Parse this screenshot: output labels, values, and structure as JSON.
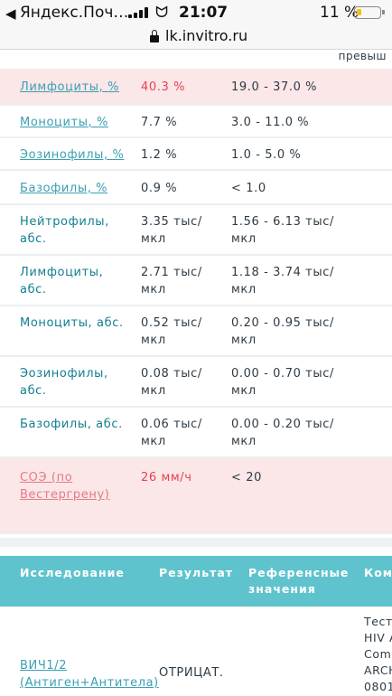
{
  "status_bar": {
    "back_label": "◀",
    "app_name": "Яндекс.Поч…",
    "wifi_glyph": "ᗢ",
    "time": "21:07",
    "battery_percent": "11 %",
    "battery_level": 0.11,
    "battery_color": "#f2c21b"
  },
  "url_bar": {
    "url": "lk.invitro.ru"
  },
  "table": {
    "partial_header": "превыш",
    "rows": [
      {
        "name": [
          "Лимфоциты, %"
        ],
        "value": [
          "40.3 %"
        ],
        "ref": [
          "19.0 - 37.0 %"
        ],
        "flagged": true,
        "link": true
      },
      {
        "name": [
          "Моноциты, %"
        ],
        "value": [
          "7.7 %"
        ],
        "ref": [
          "3.0 - 11.0 %"
        ],
        "flagged": false,
        "link": true
      },
      {
        "name": [
          "Эозинофилы, %"
        ],
        "value": [
          "1.2 %"
        ],
        "ref": [
          "1.0 - 5.0 %"
        ],
        "flagged": false,
        "link": true
      },
      {
        "name": [
          "Базофилы, %"
        ],
        "value": [
          "0.9 %"
        ],
        "ref": [
          "< 1.0"
        ],
        "flagged": false,
        "link": true
      },
      {
        "name": [
          "Нейтрофилы,",
          "абс."
        ],
        "value": [
          "3.35 тыс/",
          "мкл"
        ],
        "ref": [
          "1.56 - 6.13 тыс/",
          "мкл"
        ],
        "flagged": false,
        "link": false
      },
      {
        "name": [
          "Лимфоциты,",
          "абс."
        ],
        "value": [
          "2.71 тыс/",
          "мкл"
        ],
        "ref": [
          "1.18 - 3.74 тыс/",
          "мкл"
        ],
        "flagged": false,
        "link": false
      },
      {
        "name": [
          "Моноциты, абс."
        ],
        "value": [
          "0.52 тыс/",
          "мкл"
        ],
        "ref": [
          "0.20 - 0.95 тыс/",
          "мкл"
        ],
        "flagged": false,
        "link": false
      },
      {
        "name": [
          "Эозинофилы,",
          "абс."
        ],
        "value": [
          "0.08 тыс/",
          "мкл"
        ],
        "ref": [
          "0.00 - 0.70 тыс/",
          "мкл"
        ],
        "flagged": false,
        "link": false
      },
      {
        "name": [
          "Базофилы, абс."
        ],
        "value": [
          "0.06 тыс/",
          "мкл"
        ],
        "ref": [
          "0.00 - 0.20 тыс/",
          "мкл"
        ],
        "flagged": false,
        "link": false
      },
      {
        "name": [
          "СОЭ (по",
          "Вестергрену)"
        ],
        "value": [
          "26 мм/ч"
        ],
        "ref": [
          "< 20"
        ],
        "flagged": true,
        "link": true
      }
    ]
  },
  "table2": {
    "headers": {
      "study": "Исследование",
      "result": "Результат",
      "reference": [
        "Референсные",
        "значения"
      ],
      "comment": "Ком"
    },
    "row": {
      "name": [
        "ВИЧ1/2",
        "(Антиген+Антитела)"
      ],
      "value": "ОТРИЦАТ.",
      "comment": [
        "Тест",
        "HIV A",
        "Com",
        "ARCH",
        "0801"
      ]
    }
  },
  "colors": {
    "accent_teal": "#5fc3cd",
    "link": "#3a9fb2",
    "flag_bg": "#fbe6e8",
    "flag_text": "#e4434f"
  }
}
